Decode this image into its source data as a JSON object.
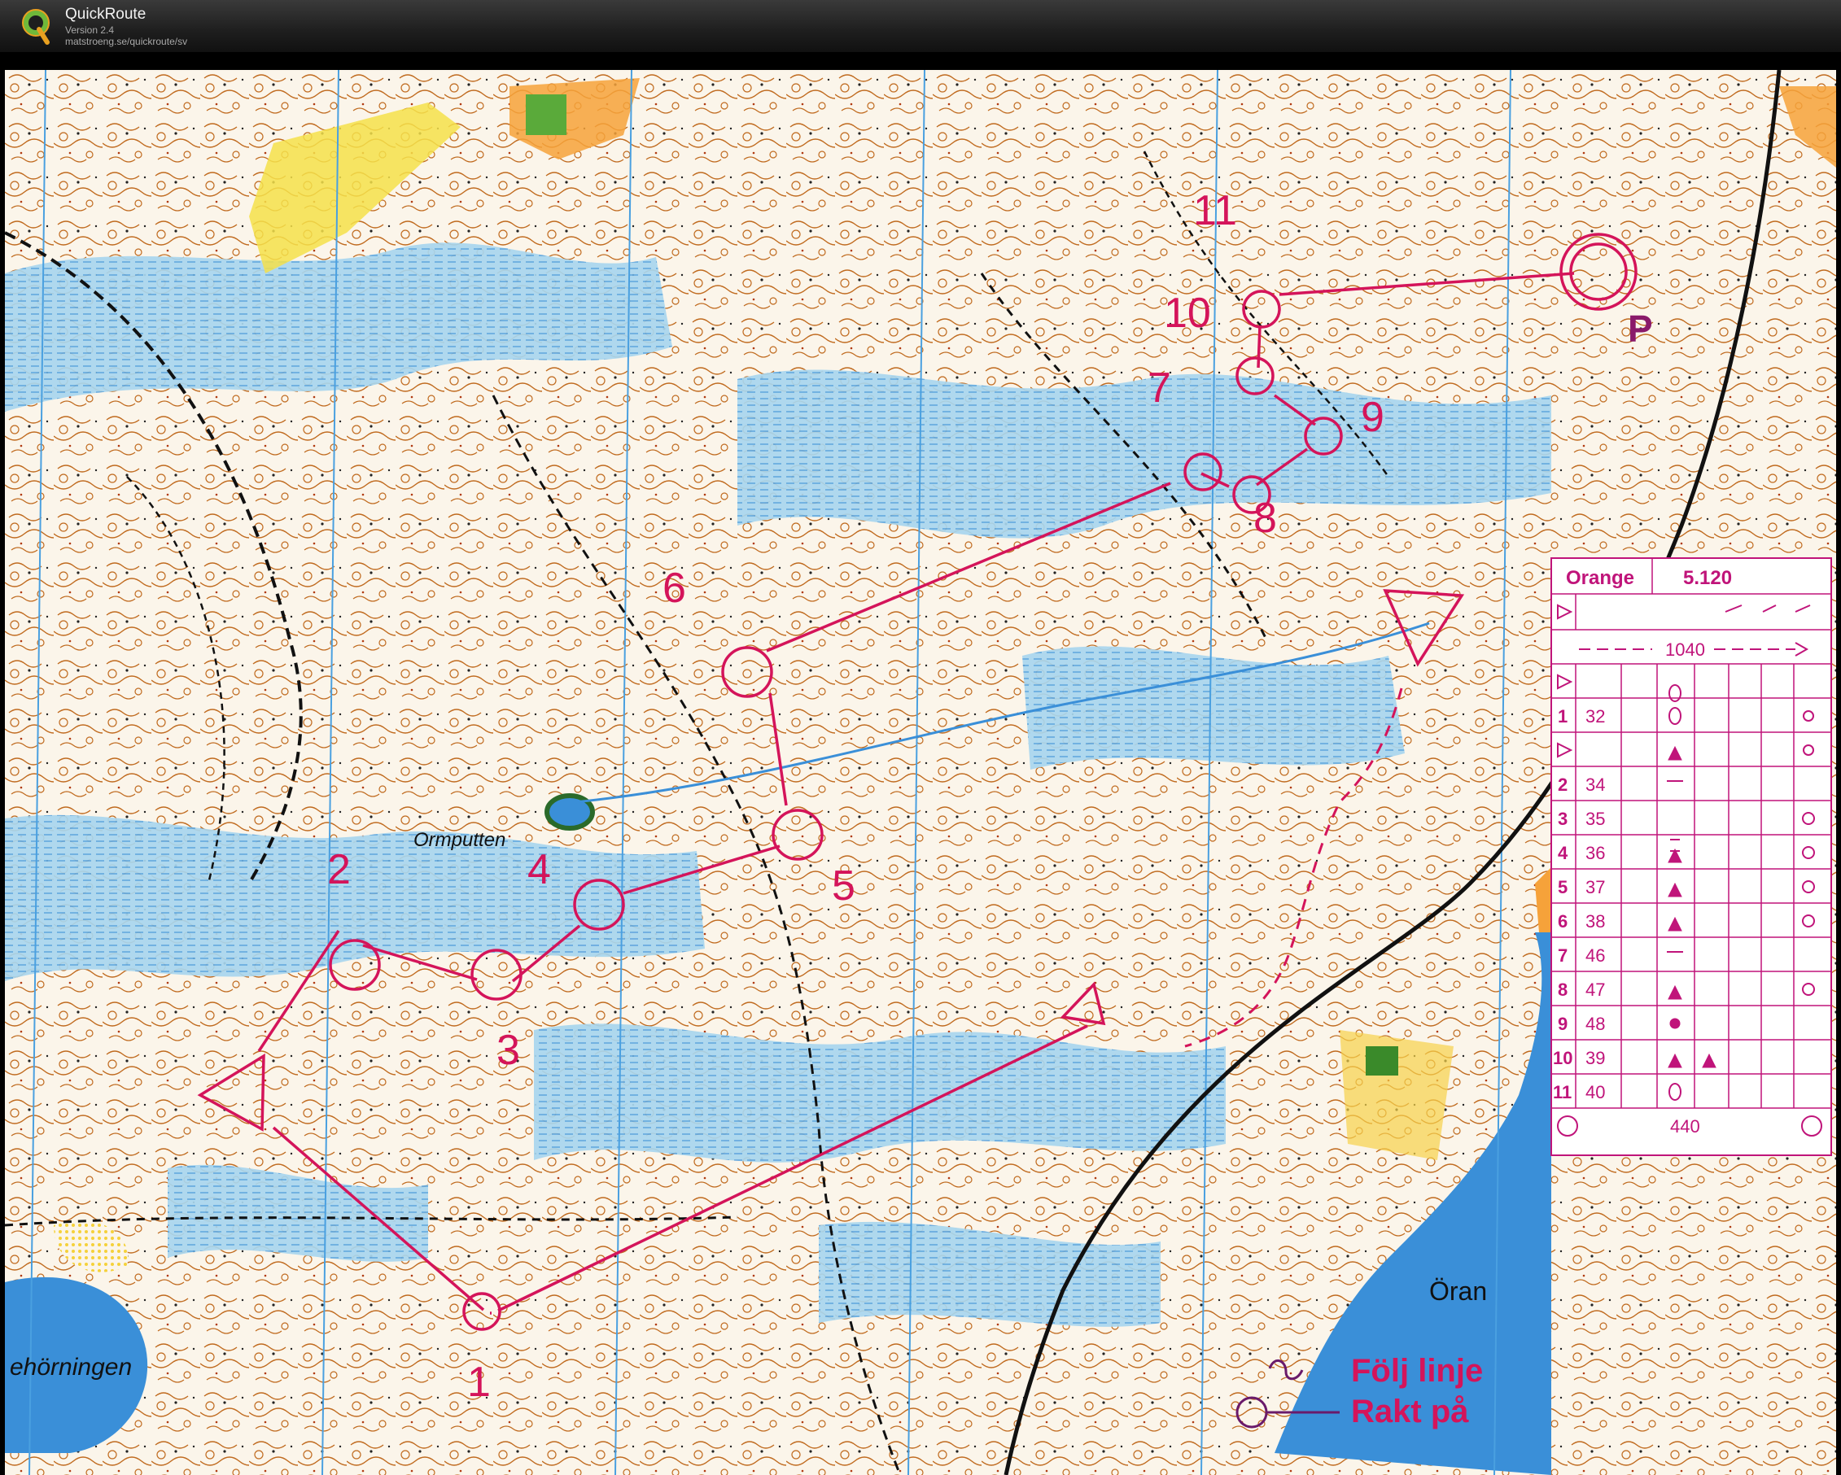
{
  "app": {
    "name": "QuickRoute",
    "version": "Version 2.4",
    "url": "matstroeng.se/quickroute/sv"
  },
  "map": {
    "place_names": {
      "ormputten": "Ormputten",
      "horningen": "ehörningen",
      "oran": "Öran"
    },
    "parking_symbol": "P",
    "legend": {
      "follow_line": "Följ linje",
      "straight": "Rakt på"
    },
    "colors": {
      "course": "#d4145a",
      "contour": "#b8641e",
      "water": "#9ed0ea",
      "lake": "#3a8fd8",
      "open": "#f6b53c",
      "paper": "#fbf7f0"
    }
  },
  "course": {
    "controls": [
      {
        "number": "1"
      },
      {
        "number": "2"
      },
      {
        "number": "3"
      },
      {
        "number": "4"
      },
      {
        "number": "5"
      },
      {
        "number": "6"
      },
      {
        "number": "7"
      },
      {
        "number": "8"
      },
      {
        "number": "9"
      },
      {
        "number": "10"
      },
      {
        "number": "11"
      }
    ]
  },
  "description_sheet": {
    "course_name": "Orange",
    "length": "5.120",
    "route_to_start": "1040",
    "finish_distance": "440",
    "rows": [
      {
        "num": "1",
        "code": "32"
      },
      {
        "num": "2",
        "code": "34"
      },
      {
        "num": "3",
        "code": "35"
      },
      {
        "num": "4",
        "code": "36"
      },
      {
        "num": "5",
        "code": "37"
      },
      {
        "num": "6",
        "code": "38"
      },
      {
        "num": "7",
        "code": "46"
      },
      {
        "num": "8",
        "code": "47"
      },
      {
        "num": "9",
        "code": "48"
      },
      {
        "num": "10",
        "code": "39"
      },
      {
        "num": "11",
        "code": "40"
      }
    ]
  }
}
